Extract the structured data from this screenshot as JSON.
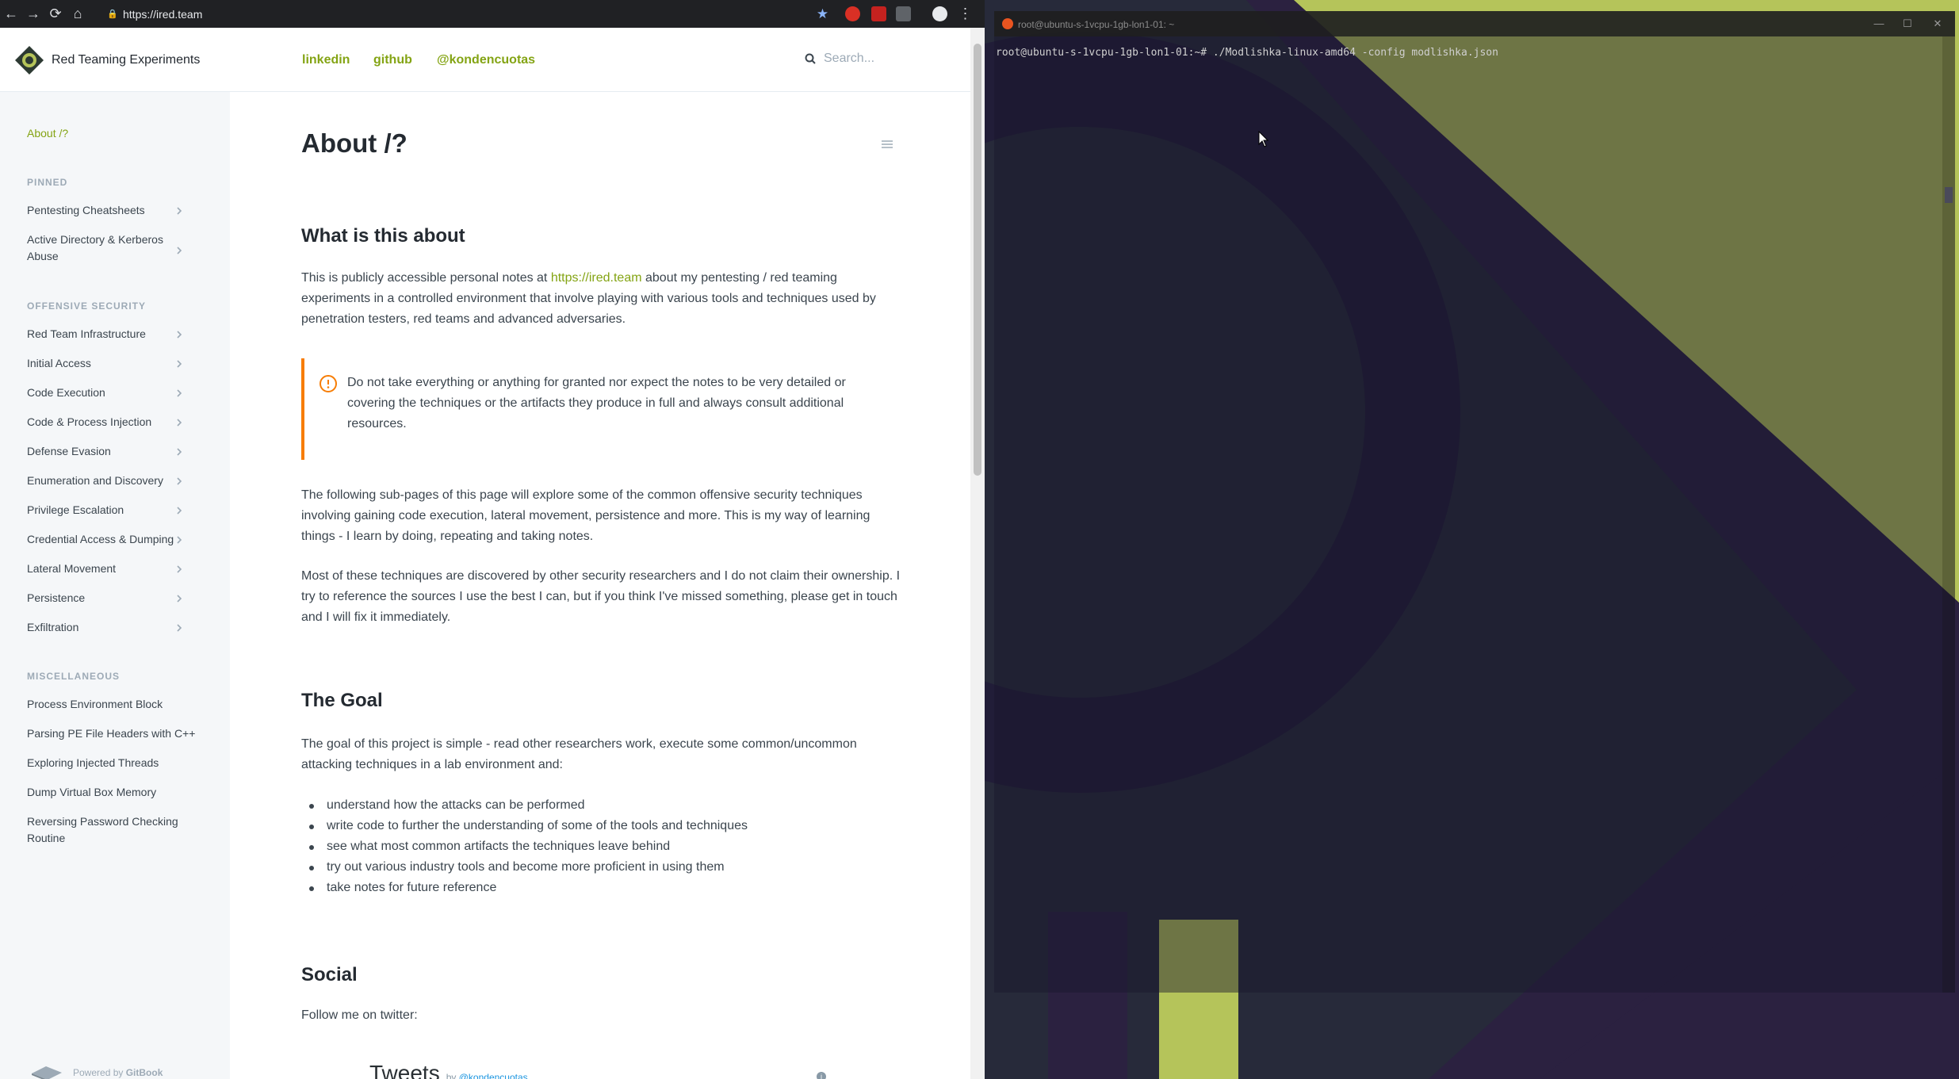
{
  "browser": {
    "url": "https://ired.team",
    "nav": {
      "back": "←",
      "forward": "→",
      "reload": "⟳",
      "home": "⌂"
    },
    "bookmark_icon": "star-icon",
    "menu_icon": "⋮"
  },
  "site": {
    "title": "Red Teaming Experiments",
    "links": [
      "linkedin",
      "github",
      "@kondencuotas"
    ],
    "search_placeholder": "Search...",
    "accent": "#84a414"
  },
  "sidebar": {
    "active": "About /?",
    "sections": [
      {
        "title": "PINNED",
        "items": [
          "Pentesting Cheatsheets",
          "Active Directory & Kerberos Abuse"
        ]
      },
      {
        "title": "OFFENSIVE SECURITY",
        "items": [
          "Red Team Infrastructure",
          "Initial Access",
          "Code Execution",
          "Code & Process Injection",
          "Defense Evasion",
          "Enumeration and Discovery",
          "Privilege Escalation",
          "Credential Access & Dumping",
          "Lateral Movement",
          "Persistence",
          "Exfiltration"
        ]
      },
      {
        "title": "MISCELLANEOUS",
        "items": [
          "Process Environment Block",
          "Parsing PE File Headers with C++",
          "Exploring Injected Threads",
          "Dump Virtual Box Memory",
          "Reversing Password Checking Routine"
        ]
      }
    ],
    "powered_by": "Powered by",
    "powered_brand": "GitBook"
  },
  "content": {
    "title": "About /?",
    "section1": {
      "heading": "What is this about",
      "p1_before": "This is publicly accessible personal notes at ",
      "p1_link": "https://ired.team",
      "p1_after": " about my pentesting / red teaming experiments in a controlled environment that involve playing with various tools and techniques used by penetration testers,  red teams and advanced adversaries.",
      "hint": "Do not take everything or anything for granted nor expect the notes to be very detailed or covering the techniques or the artifacts they produce in full and always consult additional resources.",
      "p2": "The following sub-pages of this page will explore some of the common offensive security techniques involving gaining code execution, lateral movement, persistence and more. This is my way of learning things - I learn by doing, repeating and taking notes.",
      "p3": "Most of these techniques are discovered by other security researchers and I do not claim their ownership. I try to reference the sources I use the best I can, but if you think I've missed something, please get in touch and I will fix it immediately."
    },
    "section2": {
      "heading": "The Goal",
      "p1": "The goal of this project is simple - read other researchers work, execute some common/uncommon attacking techniques in a lab environment and:",
      "bullets": [
        "understand how the attacks can be performed",
        "write code to further the understanding of some of the tools and techniques",
        "see what most common artifacts the techniques leave behind",
        "try out various industry tools and become more proficient in using them",
        "take notes for future reference"
      ]
    },
    "section3": {
      "heading": "Social",
      "p1": "Follow me on twitter:",
      "tweets_title": "Tweets",
      "tweets_by": "by",
      "tweets_handle": "@kondencuotas"
    }
  },
  "terminal": {
    "title": "root@ubuntu-s-1vcpu-1gb-lon1-01: ~",
    "prompt": "root@ubuntu-s-1vcpu-1gb-lon1-01:~#",
    "command": " ./Modlishka-linux-amd64 -config modlishka.json",
    "window_controls": [
      "—",
      "☐",
      "✕"
    ]
  }
}
